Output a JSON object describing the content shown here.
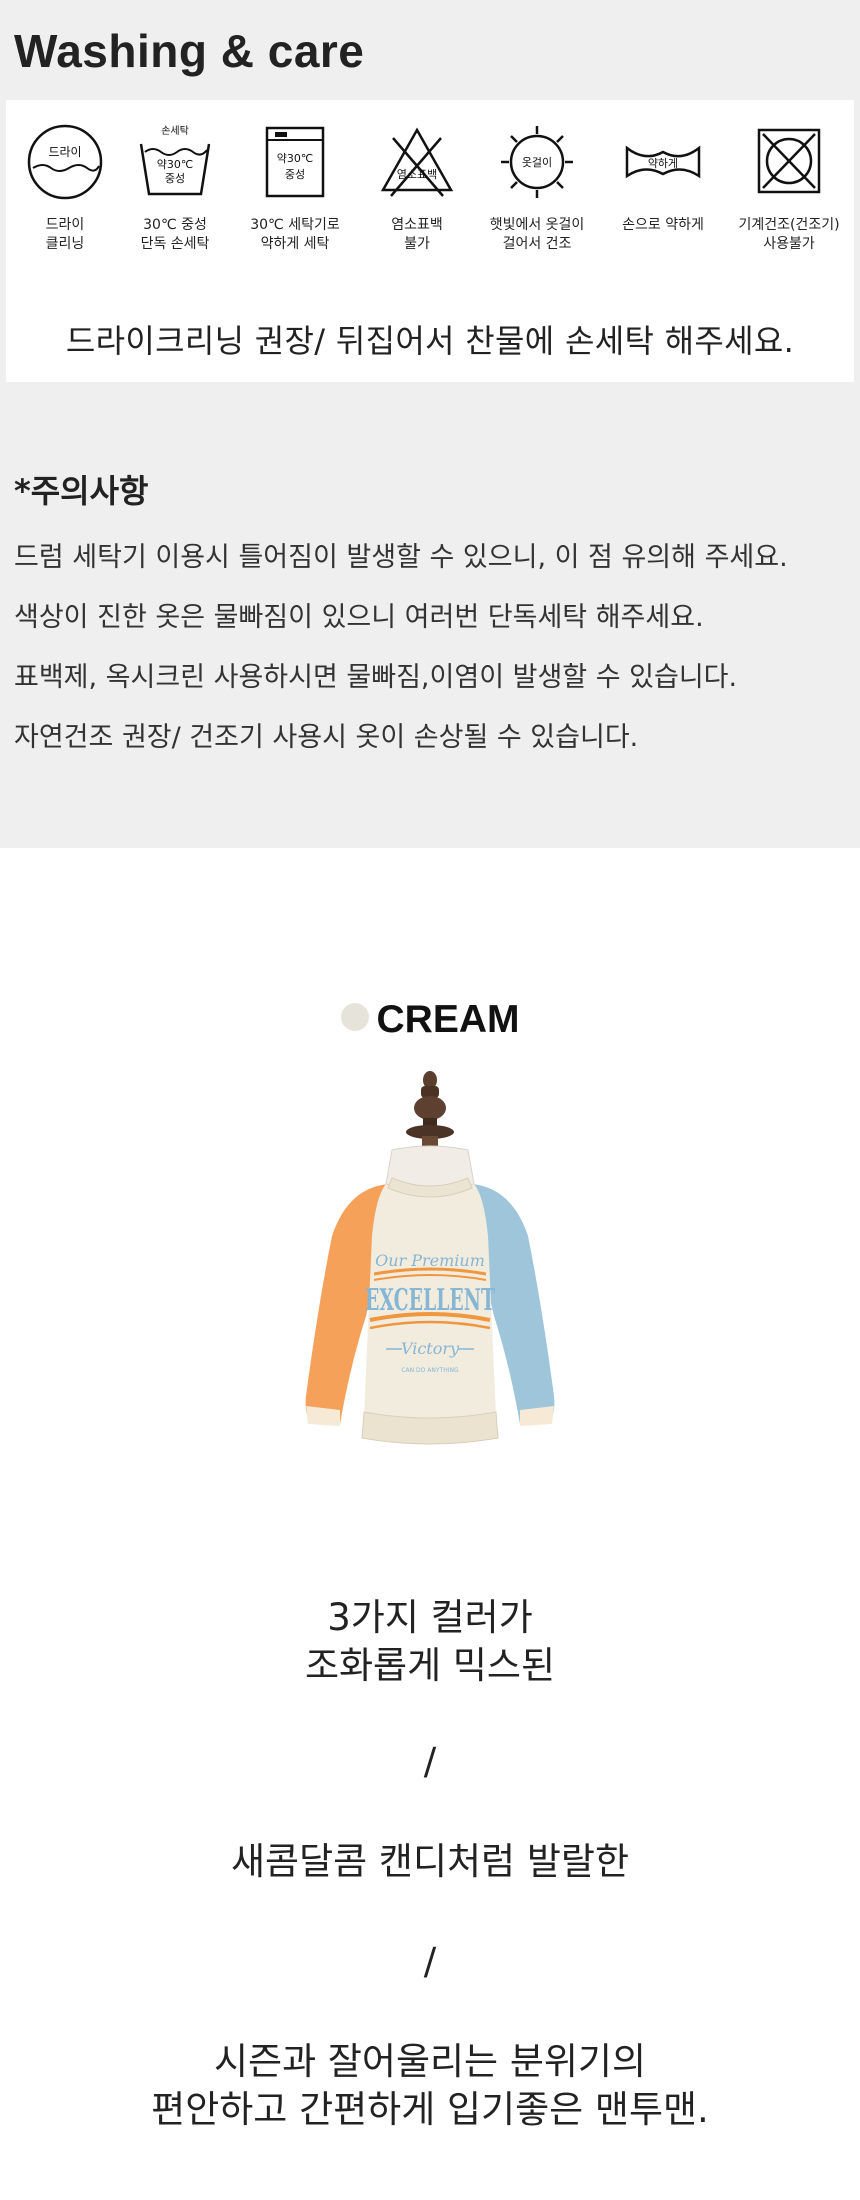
{
  "care": {
    "title": "Washing & care",
    "icons": [
      {
        "icon": "dry-clean-icon",
        "label": "드라이",
        "caption": "드라이\n클리닝"
      },
      {
        "icon": "hand-wash-icon",
        "label_top": "손세탁",
        "label_mid": "약30℃",
        "label_bottom": "중성",
        "caption": "30℃ 중성\n단독 손세탁"
      },
      {
        "icon": "machine-wash-icon",
        "label_mid": "약30℃",
        "label_bottom": "중성",
        "caption": "30℃ 세탁기로\n약하게 세탁"
      },
      {
        "icon": "no-bleach-icon",
        "label": "염소표백",
        "caption": "염소표백\n불가"
      },
      {
        "icon": "sun-hang-dry-icon",
        "label": "옷걸이",
        "caption": "햇빛에서 옷걸이\n걸어서 건조"
      },
      {
        "icon": "gentle-wring-icon",
        "label": "약하게",
        "caption": "손으로 약하게"
      },
      {
        "icon": "no-tumble-dry-icon",
        "caption": "기계건조(건조기)\n사용불가"
      }
    ],
    "recommend": "드라이크리닝 권장/ 뒤집어서 찬물에 손세탁 해주세요."
  },
  "caution": {
    "title": "*주의사항",
    "items": [
      "드럼 세탁기 이용시 틀어짐이 발생할 수 있으니, 이 점 유의해 주세요.",
      "색상이 진한 옷은 물빠짐이 있으니 여러번 단독세탁 해주세요.",
      "표백제, 옥시크린 사용하시면 물빠짐,이염이 발생할 수 있습니다.",
      "자연건조 권장/ 건조기 사용시 옷이 손상될 수 있습니다."
    ]
  },
  "product": {
    "color_name": "CREAM",
    "color_swatch": "#e6e3da",
    "sweatshirt_text": {
      "line1": "Our Premium",
      "line2": "EXCELLENT",
      "line3": "Victory",
      "line4": "CAN DO ANYTHING"
    },
    "colors": {
      "body": "#f2ecdf",
      "left_sleeve": "#f5a15a",
      "right_sleeve": "#9ec5da",
      "print_blue": "#86b6d3",
      "print_orange": "#f0963f"
    },
    "desc": [
      "3가지 컬러가\n조화롭게 믹스된",
      "/",
      "새콤달콤 캔디처럼 발랄한",
      "/",
      "시즌과 잘어울리는 분위기의\n편안하고 간편하게 입기좋은 맨투맨."
    ]
  }
}
